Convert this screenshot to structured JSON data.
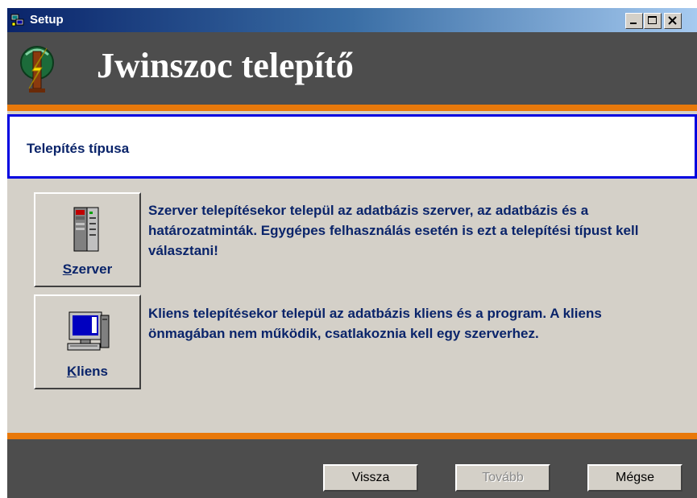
{
  "window": {
    "title": "Setup",
    "controls": [
      "minimize-icon",
      "maximize-icon",
      "close-icon"
    ]
  },
  "banner": {
    "title": "Jwinszoc telepítő"
  },
  "section": {
    "title": "Telepítés típusa"
  },
  "options": [
    {
      "label": "Szerver",
      "mnemonic": "S",
      "label_rest": "zerver",
      "icon": "server-icon",
      "description": "Szerver telepítésekor települ az adatbázis szerver, az adatbázis és a határozatminták. Egygépes felhasználás esetén is ezt a telepítési típust kell választani!"
    },
    {
      "label": "Kliens",
      "mnemonic": "K",
      "label_rest": "liens",
      "icon": "computer-icon",
      "description": "Kliens telepítésekor települ az adatbázis kliens és a program. A kliens önmagában nem működik, csatlakoznia kell egy szerverhez."
    }
  ],
  "buttons": {
    "back": "Vissza",
    "next": "Tovább",
    "cancel": "Mégse"
  },
  "colors": {
    "title_gradient_start": "#0a246a",
    "banner_bg": "#4d4d4d",
    "accent_orange": "#e8780a",
    "section_border": "#0000e0",
    "text_navy": "#0a246a",
    "dialog_bg": "#d4d0c8"
  }
}
